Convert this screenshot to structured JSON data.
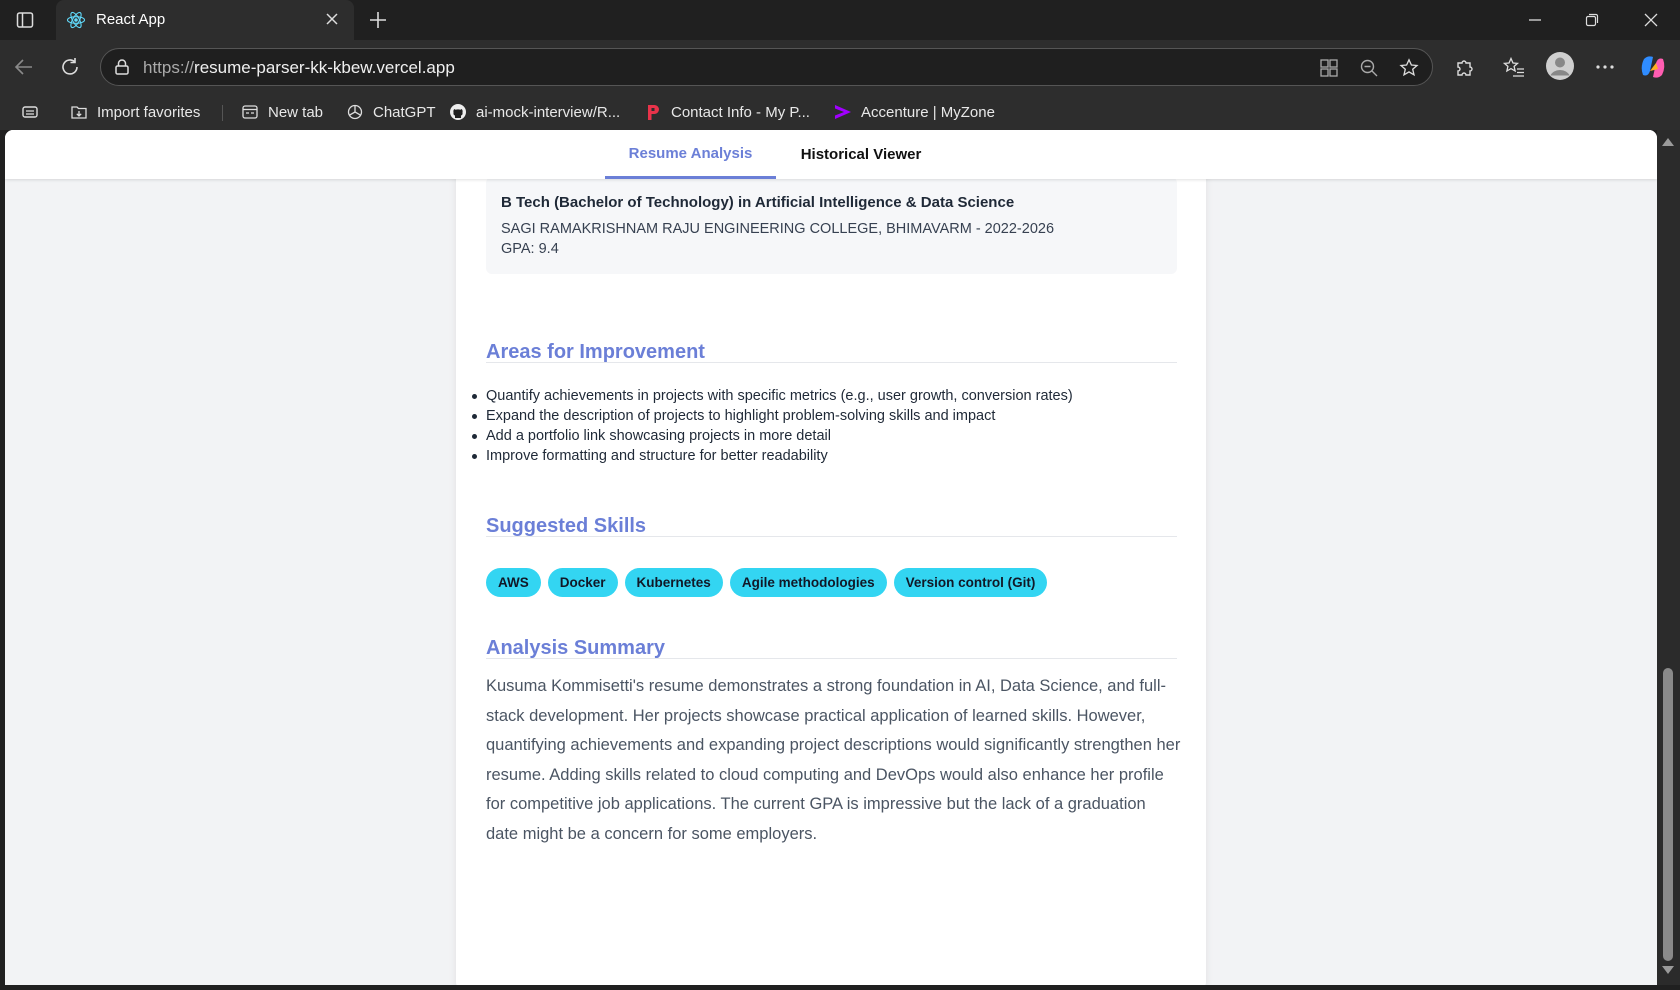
{
  "browser": {
    "tab_title": "React App",
    "url_prefix": "https://",
    "url_host": "resume-parser-kk-kbew.vercel.app",
    "bookmarks": [
      {
        "label": "Import favorites",
        "icon": "import-icon"
      },
      {
        "label": "New tab",
        "icon": "new-tab-icon"
      },
      {
        "label": "ChatGPT",
        "icon": "chatgpt-icon"
      },
      {
        "label": "ai-mock-interview/R...",
        "icon": "github-icon"
      },
      {
        "label": "Contact Info - My P...",
        "icon": "p-logo-icon"
      },
      {
        "label": "Accenture | MyZone",
        "icon": "accenture-icon"
      }
    ]
  },
  "app_nav": {
    "tabs": [
      {
        "label": "Resume Analysis",
        "active": true
      },
      {
        "label": "Historical Viewer",
        "active": false
      }
    ],
    "accent_color": "#6b7fd7"
  },
  "education": {
    "degree": "B Tech (Bachelor of Technology) in Artificial Intelligence & Data Science",
    "school_line": "SAGI RAMAKRISHNAM RAJU ENGINEERING COLLEGE, BHIMAVARM - 2022-2026",
    "gpa_line": "GPA: 9.4"
  },
  "improvement": {
    "title": "Areas for Improvement",
    "items": [
      "Quantify achievements in projects with specific metrics (e.g., user growth, conversion rates)",
      "Expand the description of projects to highlight problem-solving skills and impact",
      "Add a portfolio link showcasing projects in more detail",
      "Improve formatting and structure for better readability"
    ]
  },
  "skills": {
    "title": "Suggested Skills",
    "chip_color": "#33d5f2",
    "items": [
      "AWS",
      "Docker",
      "Kubernetes",
      "Agile methodologies",
      "Version control (Git)"
    ]
  },
  "summary": {
    "title": "Analysis Summary",
    "text": "Kusuma Kommisetti's resume demonstrates a strong foundation in AI, Data Science, and full-stack development. Her projects showcase practical application of learned skills. However, quantifying achievements and expanding project descriptions would significantly strengthen her resume. Adding skills related to cloud computing and DevOps would also enhance her profile for competitive job applications. The current GPA is impressive but the lack of a graduation date might be a concern for some employers."
  }
}
